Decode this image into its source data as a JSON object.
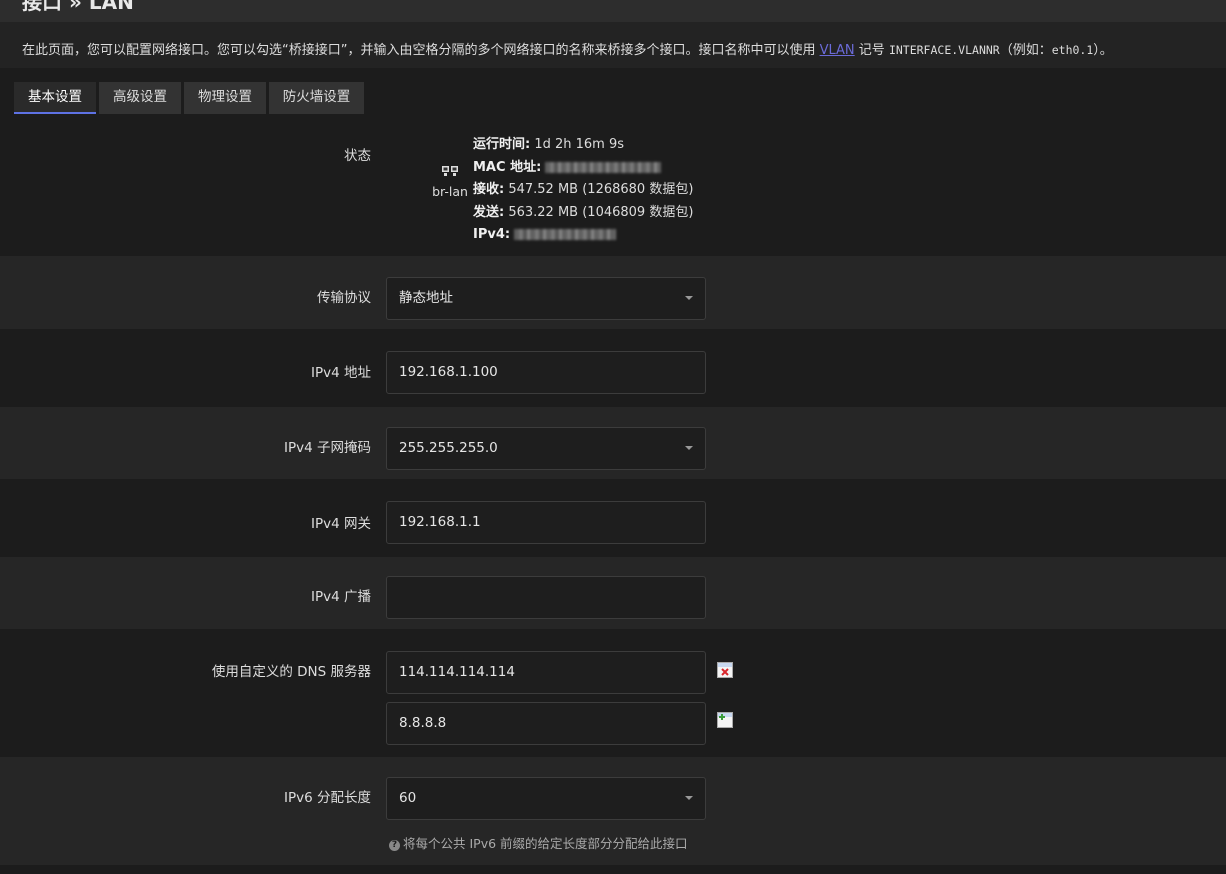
{
  "page": {
    "title": "接口 » LAN"
  },
  "description": {
    "text_before_link": "在此页面，您可以配置网络接口。您可以勾选“桥接接口”，并输入由空格分隔的多个网络接口的名称来桥接多个接口。接口名称中可以使用 ",
    "link": "VLAN",
    "text_after_link": " 记号 ",
    "code1": "INTERFACE.VLANNR",
    "text_paren": "（例如：",
    "code2": "eth0.1",
    "text_end": "）。"
  },
  "tabs": [
    {
      "label": "基本设置"
    },
    {
      "label": "高级设置"
    },
    {
      "label": "物理设置"
    },
    {
      "label": "防火墙设置"
    }
  ],
  "status": {
    "label": "状态",
    "interface": "br-lan",
    "uptime_label": "运行时间:",
    "uptime": "1d 2h 16m 9s",
    "mac_label": "MAC 地址:",
    "rx_label": "接收:",
    "rx": "547.52 MB (1268680 数据包)",
    "tx_label": "发送:",
    "tx": "563.22 MB (1046809 数据包)",
    "ipv4_label": "IPv4:"
  },
  "form": {
    "protocol": {
      "label": "传输协议",
      "value": "静态地址"
    },
    "ipv4_addr": {
      "label": "IPv4 地址",
      "value": "192.168.1.100"
    },
    "ipv4_mask": {
      "label": "IPv4 子网掩码",
      "value": "255.255.255.0"
    },
    "ipv4_gateway": {
      "label": "IPv4 网关",
      "value": "192.168.1.1"
    },
    "ipv4_broadcast": {
      "label": "IPv4 广播",
      "value": ""
    },
    "dns": {
      "label": "使用自定义的 DNS 服务器",
      "values": [
        "114.114.114.114",
        "8.8.8.8"
      ]
    },
    "ipv6_assign": {
      "label": "IPv6 分配长度",
      "value": "60",
      "hint": "将每个公共 IPv6 前缀的给定长度部分分配给此接口"
    }
  },
  "colors": {
    "accent": "#5e72e4",
    "link": "#6b6bd8",
    "remove": "#d9262c",
    "add": "#3a9c3a"
  },
  "icons": {
    "remove": "remove-icon",
    "add": "add-icon",
    "help": "help-icon",
    "interface": "network-interface-icon"
  }
}
